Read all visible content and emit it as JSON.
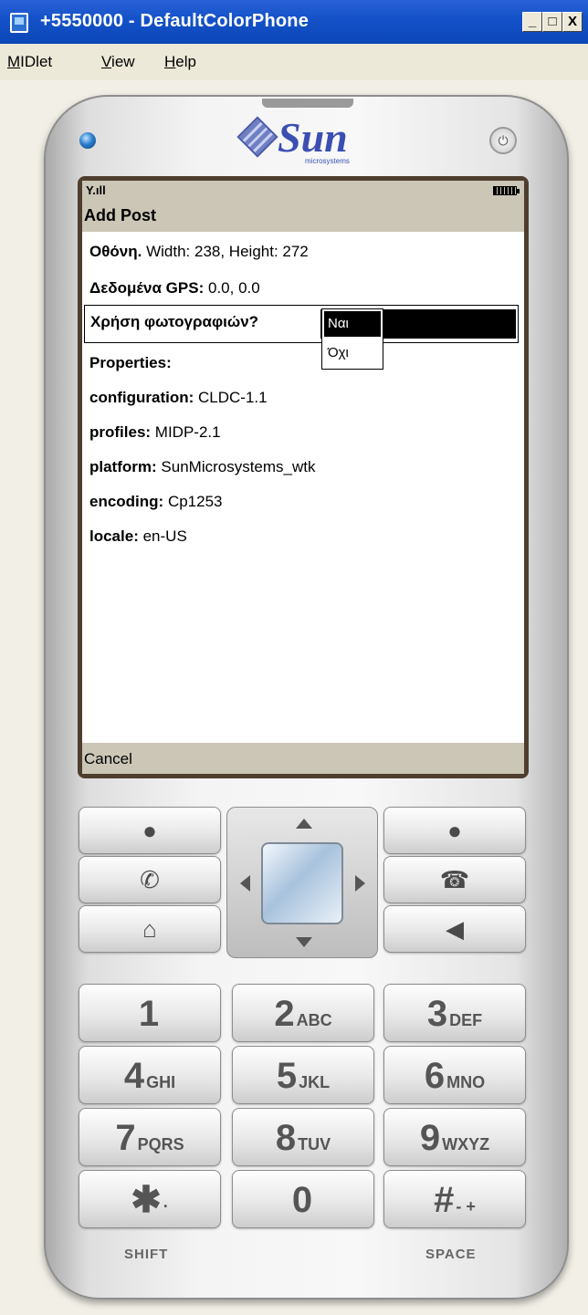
{
  "window": {
    "title": "+5550000 - DefaultColorPhone",
    "controls": {
      "minimize": "_",
      "maximize": "□",
      "close": "X"
    }
  },
  "menubar": {
    "items": [
      {
        "first": "M",
        "rest": "IDlet"
      },
      {
        "first": "V",
        "rest": "iew"
      },
      {
        "first": "H",
        "rest": "elp"
      }
    ]
  },
  "phone": {
    "brand": "Sun",
    "brand_sub": "microsystems",
    "power_icon": "power-icon"
  },
  "screen": {
    "title": "Add Post",
    "rows": [
      {
        "label": "Οθόνη.",
        "value": "Width: 238, Height: 272"
      },
      {
        "label": "Δεδομένα GPS:",
        "value": "0.0, 0.0"
      }
    ],
    "choice": {
      "label": "Χρήση φωτογραφιών?",
      "options": [
        "Ναι",
        "Όχι"
      ],
      "selected": "Ναι"
    },
    "properties_header": "Properties:",
    "properties": [
      {
        "label": "configuration:",
        "value": "CLDC-1.1"
      },
      {
        "label": "profiles:",
        "value": "MIDP-2.1"
      },
      {
        "label": "platform:",
        "value": "SunMicrosystems_wtk"
      },
      {
        "label": "encoding:",
        "value": "Cp1253"
      },
      {
        "label": "locale:",
        "value": "en-US"
      }
    ],
    "softkey_left": "Cancel"
  },
  "keypad": {
    "left_keys": [
      "softkey-left-dot",
      "call-icon",
      "home-icon"
    ],
    "right_keys": [
      "softkey-right-dot",
      "end-call-icon",
      "clear-icon"
    ],
    "numbers": [
      {
        "num": "1",
        "letters": ""
      },
      {
        "num": "2",
        "letters": "ABC"
      },
      {
        "num": "3",
        "letters": "DEF"
      },
      {
        "num": "4",
        "letters": "GHI"
      },
      {
        "num": "5",
        "letters": "JKL"
      },
      {
        "num": "6",
        "letters": "MNO"
      },
      {
        "num": "7",
        "letters": "PQRS"
      },
      {
        "num": "8",
        "letters": "TUV"
      },
      {
        "num": "9",
        "letters": "WXYZ"
      },
      {
        "num": "✱",
        "letters": "·"
      },
      {
        "num": "0",
        "letters": ""
      },
      {
        "num": "#",
        "letters": "- +"
      }
    ],
    "shift_label": "SHIFT",
    "space_label": "SPACE"
  }
}
